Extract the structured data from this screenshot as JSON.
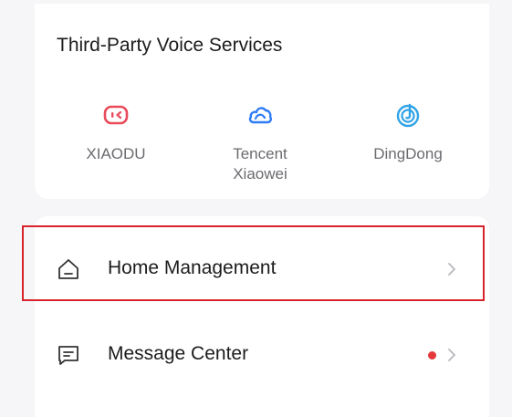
{
  "voice_services": {
    "title": "Third-Party Voice Services",
    "items": [
      {
        "name": "XIAODU",
        "icon": "xiaodu-icon",
        "color": "#e94b5a"
      },
      {
        "name": "Tencent Xiaowei",
        "icon": "cloud-icon",
        "color": "#2f7cf6"
      },
      {
        "name": "DingDong",
        "icon": "dingdong-icon",
        "color": "#2fa3e6"
      }
    ]
  },
  "menu": {
    "items": [
      {
        "label": "Home Management",
        "icon": "home-icon",
        "highlighted": true
      },
      {
        "label": "Message Center",
        "icon": "message-icon",
        "has_badge": true
      }
    ]
  },
  "colors": {
    "highlight_border": "#d8232a",
    "badge": "#e5383b",
    "chevron": "#b8b8bd"
  }
}
